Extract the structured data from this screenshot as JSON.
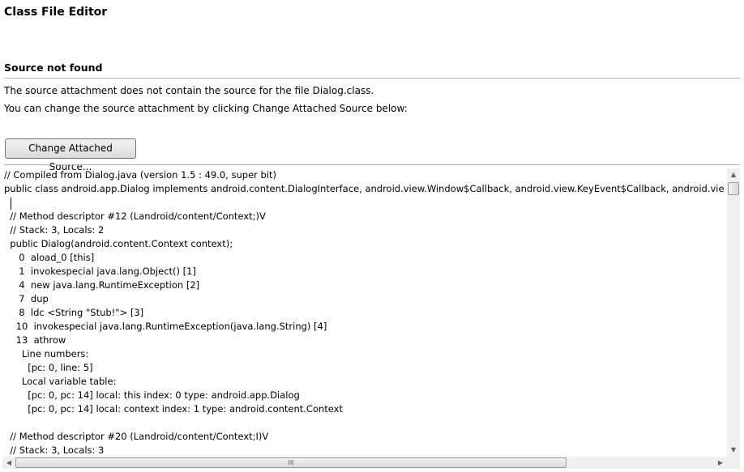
{
  "page": {
    "title": "Class File Editor",
    "subtitle": "Source not found",
    "message_line1": "The source attachment does not contain the source for the file Dialog.class.",
    "message_line2": "You can change the source attachment by clicking Change Attached Source below:",
    "change_source_button": "Change Attached Source..."
  },
  "editor": {
    "lines": [
      "// Compiled from Dialog.java (version 1.5 : 49.0, super bit)",
      "public class android.app.Dialog implements android.content.DialogInterface, android.view.Window$Callback, android.view.KeyEvent$Callback, android.vie",
      "",
      "  // Method descriptor #12 (Landroid/content/Context;)V",
      "  // Stack: 3, Locals: 2",
      "  public Dialog(android.content.Context context);",
      "     0  aload_0 [this]",
      "     1  invokespecial java.lang.Object() [1]",
      "     4  new java.lang.RuntimeException [2]",
      "     7  dup",
      "     8  ldc <String \"Stub!\"> [3]",
      "    10  invokespecial java.lang.RuntimeException(java.lang.String) [4]",
      "    13  athrow",
      "      Line numbers:",
      "        [pc: 0, line: 5]",
      "      Local variable table:",
      "        [pc: 0, pc: 14] local: this index: 0 type: android.app.Dialog",
      "        [pc: 0, pc: 14] local: context index: 1 type: android.content.Context",
      "",
      "  // Method descriptor #20 (Landroid/content/Context;I)V",
      "  // Stack: 3, Locals: 3"
    ],
    "scroll_up_glyph": "▲",
    "scroll_down_glyph": "▼",
    "scroll_left_glyph": "◀",
    "scroll_right_glyph": "▶",
    "hscroll_grip": "III"
  }
}
